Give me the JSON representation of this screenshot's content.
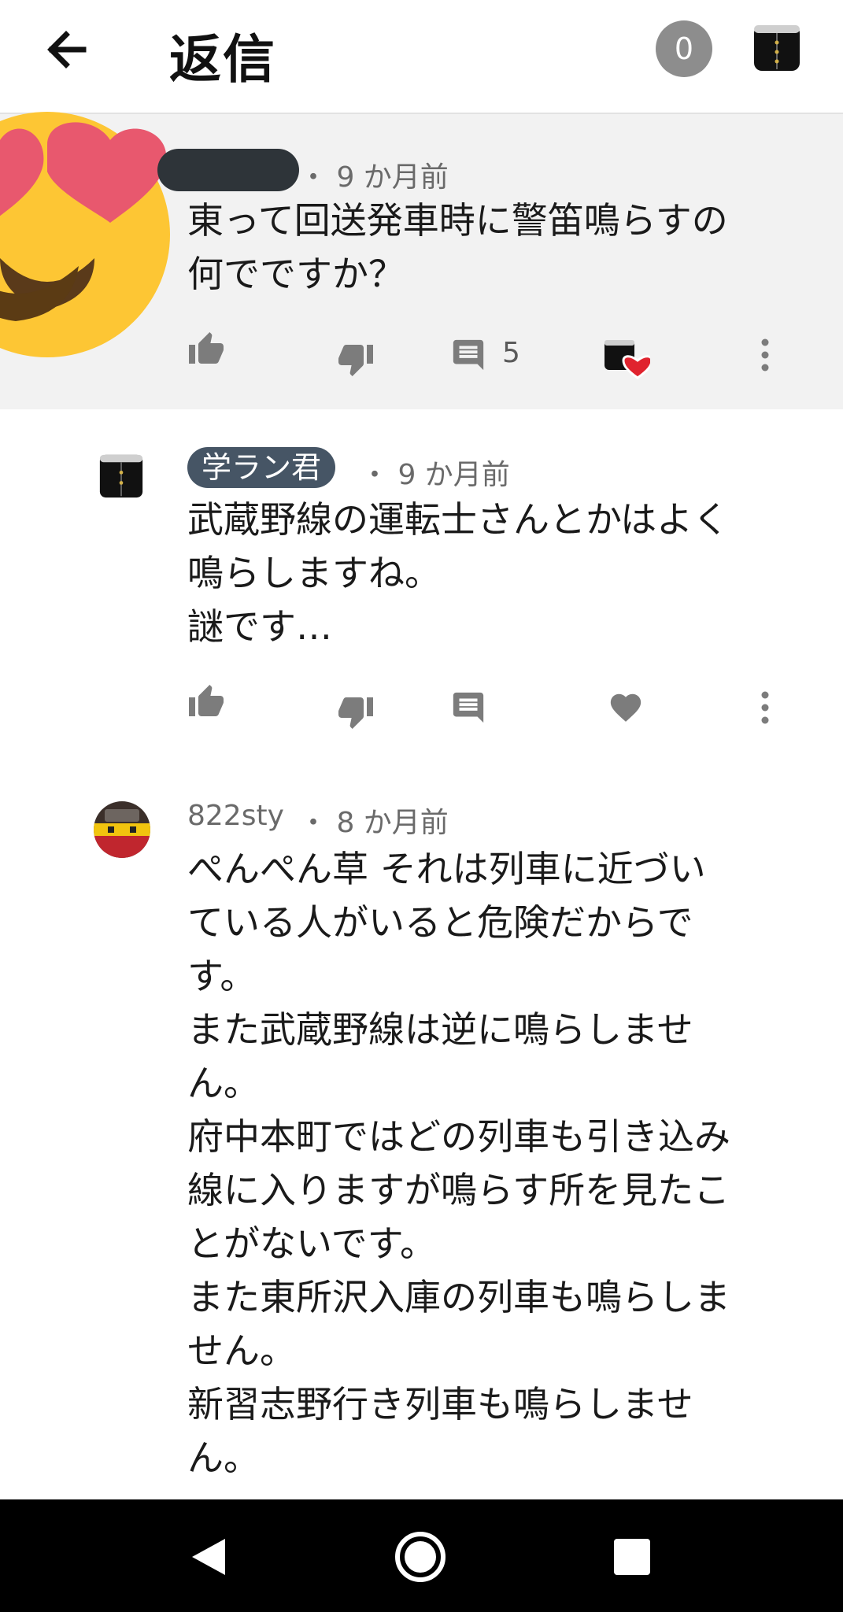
{
  "header": {
    "title": "返信",
    "counter": "0"
  },
  "parent_comment": {
    "time": "・ 9 か月前",
    "text": "東って回送発車時に警笛鳴らすの\n何でですか？",
    "reply_count": "5"
  },
  "replies": [
    {
      "author": "学ラン君",
      "time": "・ 9 か月前",
      "text": "武蔵野線の運転士さんとかはよく\n鳴らしますね。\n謎です…"
    },
    {
      "author": "822sty",
      "time": "・ 8 か月前",
      "text": "ぺんぺん草 それは列車に近づい\nている人がいると危険だからで\nす。\nまた武蔵野線は逆に鳴らしませ\nん。\n府中本町ではどの列車も引き込み\n線に入りますが鳴らす所を見たこ\nとがないです。\nまた東所沢入庫の列車も鳴らしま\nせん。\n新習志野行き列車も鳴らしませ\nん。"
    }
  ],
  "colors": {
    "chip_bg": "#465565",
    "heart_red": "#e0232e",
    "emoji_yellow": "#fdc634",
    "emoji_heart": "#e8586e"
  },
  "icons": [
    "back-arrow-icon",
    "thumb-up-icon",
    "thumb-down-icon",
    "comment-icon",
    "heart-icon",
    "more-vert-icon",
    "nav-back-icon",
    "nav-home-icon",
    "nav-recents-icon"
  ]
}
